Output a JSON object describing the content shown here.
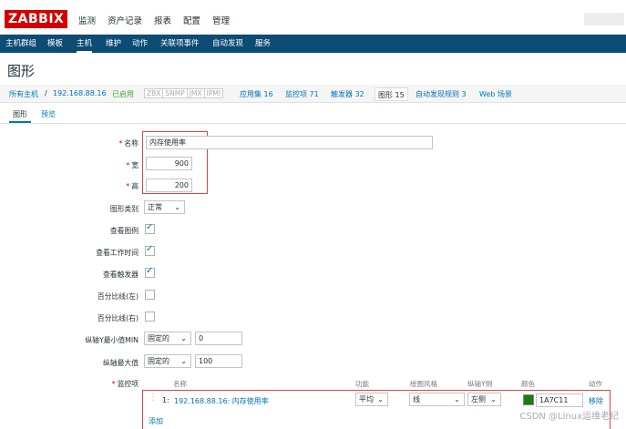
{
  "logo": "ZABBIX",
  "top_menu": [
    "监测",
    "资产记录",
    "报表",
    "配置",
    "管理"
  ],
  "sub_menu": [
    "主机群组",
    "模板",
    "主机",
    "维护",
    "动作",
    "关联项事件",
    "自动发现",
    "服务"
  ],
  "page_title": "图形",
  "breadcrumb": {
    "all_hosts": "所有主机",
    "separator": "/",
    "host": "192.168.88.16",
    "status": "已启用",
    "badges": [
      "ZBX",
      "SNMP",
      "JMX",
      "IPMI"
    ],
    "apps": "应用集 16",
    "items": "监控项 71",
    "triggers": "触发器 32",
    "graphs": "图形 15",
    "discovery": "自动发现规则 3",
    "web": "Web 场景"
  },
  "tabs": [
    "图形",
    "预览"
  ],
  "form": {
    "name_label": "名称",
    "name_value": "内存使用率",
    "width_label": "宽",
    "width_value": "900",
    "height_label": "高",
    "height_value": "200",
    "graph_type_label": "图形类别",
    "graph_type_value": "正常",
    "show_legend_label": "查看图例",
    "show_work_period_label": "查看工作时间",
    "show_triggers_label": "查看触发器",
    "percentile_left_label": "百分比线(左)",
    "percentile_right_label": "百分比线(右)",
    "ymin_label": "纵轴Y最小值MIN",
    "ymin_type": "固定的",
    "ymin_value": "0",
    "ymax_label": "纵轴最大值",
    "ymax_type": "固定的",
    "ymax_value": "100",
    "items_label": "监控项"
  },
  "items_table": {
    "headers": [
      "名称",
      "功能",
      "绘图风格",
      "纵轴Y侧",
      "颜色",
      "动作"
    ],
    "rows": [
      {
        "index": "1:",
        "name": "192.168.88.16: 内存使用率",
        "function": "平均",
        "style": "线",
        "yaxis": "左侧",
        "color": "1A7C11",
        "action": "移除"
      }
    ],
    "add_label": "添加"
  },
  "watermark": "CSDN @Linux运维老纪",
  "colors": {
    "brand_red": "#d40000",
    "nav_blue": "#0d4c74",
    "link_blue": "#0275b8",
    "item_color": "#1A7C11"
  }
}
